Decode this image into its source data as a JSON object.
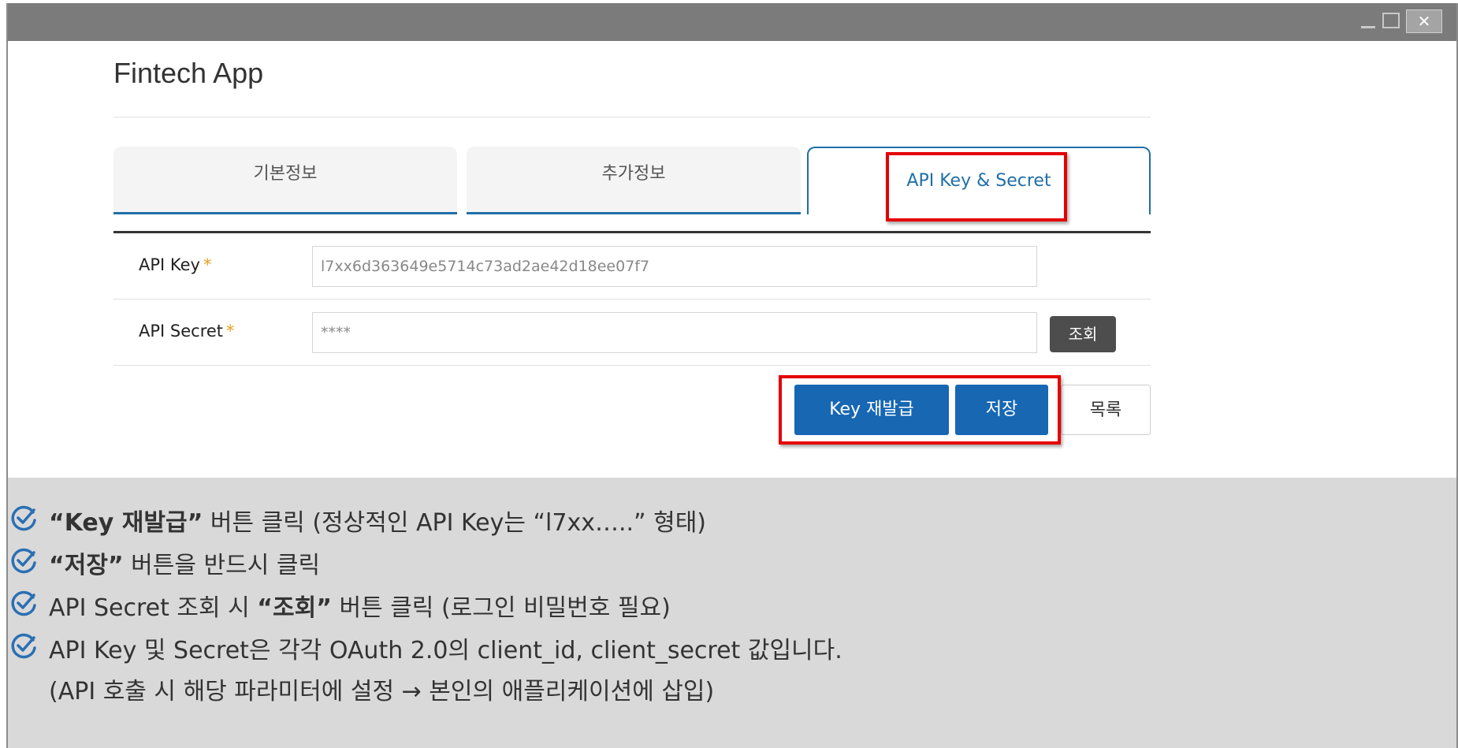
{
  "window": {
    "close_label": "✕"
  },
  "app": {
    "title": "Fintech App"
  },
  "tabs": [
    {
      "label": "기본정보"
    },
    {
      "label": "추가정보"
    },
    {
      "label": "API Key & Secret"
    }
  ],
  "form": {
    "api_key": {
      "label": "API Key",
      "required_mark": "*",
      "value": "l7xx6d363649e5714c73ad2ae42d18ee07f7"
    },
    "api_secret": {
      "label": "API Secret",
      "required_mark": "*",
      "value": "****",
      "view_button": "조회"
    }
  },
  "actions": {
    "reissue": "Key 재발급",
    "save": "저장",
    "list": "목록"
  },
  "notes": {
    "n1": {
      "q": "“Key 재발급”",
      "rest": " 버튼 클릭 (정상적인 API Key는 “l7xx…..” 형태)"
    },
    "n2": {
      "q": "“저장”",
      "rest": " 버튼을 반드시 클릭"
    },
    "n3": {
      "pre": "API Secret 조회 시 ",
      "q": "“조회”",
      "rest": " 버튼 클릭 (로그인 비밀번호 필요)"
    },
    "n4": {
      "text": "API Key 및 Secret은 각각 OAuth 2.0의 client_id, client_secret 값입니다."
    },
    "n5": {
      "text": "(API 호출 시 해당 파라미터에 설정 → 본인의 애플리케이션에 삽입)"
    }
  },
  "colors": {
    "accent": "#1767b3",
    "highlight": "#e50000",
    "required": "#e8a020",
    "check": "#2a6fb3"
  }
}
